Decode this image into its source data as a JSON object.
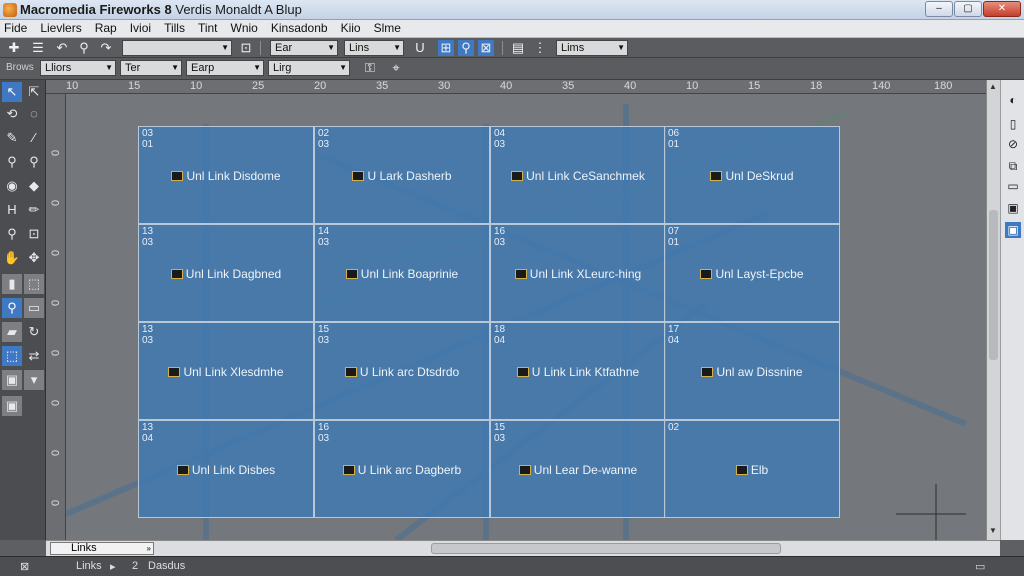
{
  "window": {
    "title": "Macromedia Fireworks 8",
    "subtitle": "Verdis Monaldt A Blup",
    "controls": [
      "minimize",
      "maximize",
      "close"
    ]
  },
  "menu": [
    "Fide",
    "Lievlers",
    "Rap",
    "Ivioi",
    "Tills",
    "Tint",
    "Wnio",
    "Kinsadonb",
    "Kiio",
    "Slme"
  ],
  "toolbar1": {
    "dropdown_empty": "",
    "font_dropdown": "Ear",
    "lines_dropdown": "Lins",
    "links_dropdown": "Lims"
  },
  "toolbar2": {
    "label": "Brows",
    "d1": "Lliors",
    "d2": "Ter",
    "d3": "Earp",
    "d4": "Lirg"
  },
  "ruler": {
    "h_ticks": [
      "10",
      "15",
      "10",
      "25",
      "20",
      "35",
      "30",
      "40",
      "35",
      "40",
      "10",
      "15",
      "18",
      "140",
      "180"
    ],
    "v_ticks": [
      "0",
      "0",
      "0",
      "0",
      "0",
      "0",
      "0",
      "0",
      "0"
    ]
  },
  "cells": [
    {
      "nums": "03\n01",
      "label": "Unl  Link Disdome"
    },
    {
      "nums": "02\n03",
      "label": "U  Lark Dasherb"
    },
    {
      "nums": "04\n03",
      "label": "Unl  Link CeSanchmek"
    },
    {
      "nums": "06\n01",
      "label": "Unl  DeSkrud"
    },
    {
      "nums": "13\n03",
      "label": "Unl  Link Dagbned"
    },
    {
      "nums": "14\n03",
      "label": "Unl  Link Boaprinie"
    },
    {
      "nums": "16\n03",
      "label": "Unl  Link  XLeurc-hing"
    },
    {
      "nums": "07\n01",
      "label": "Unl  Layst-Epcbe"
    },
    {
      "nums": "13\n03",
      "label": "Unl  Link Xlesdmhe"
    },
    {
      "nums": "15\n03",
      "label": "U  Link arc Dtsdrdo"
    },
    {
      "nums": "18\n04",
      "label": "U  Link Link Ktfathne"
    },
    {
      "nums": "17\n04",
      "label": "Unl  aw Dissnine"
    },
    {
      "nums": "13\n04",
      "label": "Unl  Link Disbes"
    },
    {
      "nums": "16\n03",
      "label": "U  Link arc Dagberb"
    },
    {
      "nums": "15\n03",
      "label": "Unl  Lear De-wanne"
    },
    {
      "nums": "02\n",
      "label": "Elb"
    }
  ],
  "bottom": {
    "frames_dropdown": "Links",
    "status_left": "Links",
    "status_mid": "2",
    "status_right": "Dasdus"
  },
  "colors": {
    "slice_fill": "#4a7fb6",
    "canvas_bg": "#74777b",
    "accent": "#3f78c3"
  },
  "icons": [
    "pointer-icon",
    "subselect-icon",
    "lasso-icon",
    "magic-wand-icon",
    "zoom-icon",
    "hand-icon",
    "pencil-icon",
    "eraser-icon",
    "eyedropper-icon",
    "paint-bucket-icon",
    "slice-icon",
    "hotspot-icon"
  ]
}
